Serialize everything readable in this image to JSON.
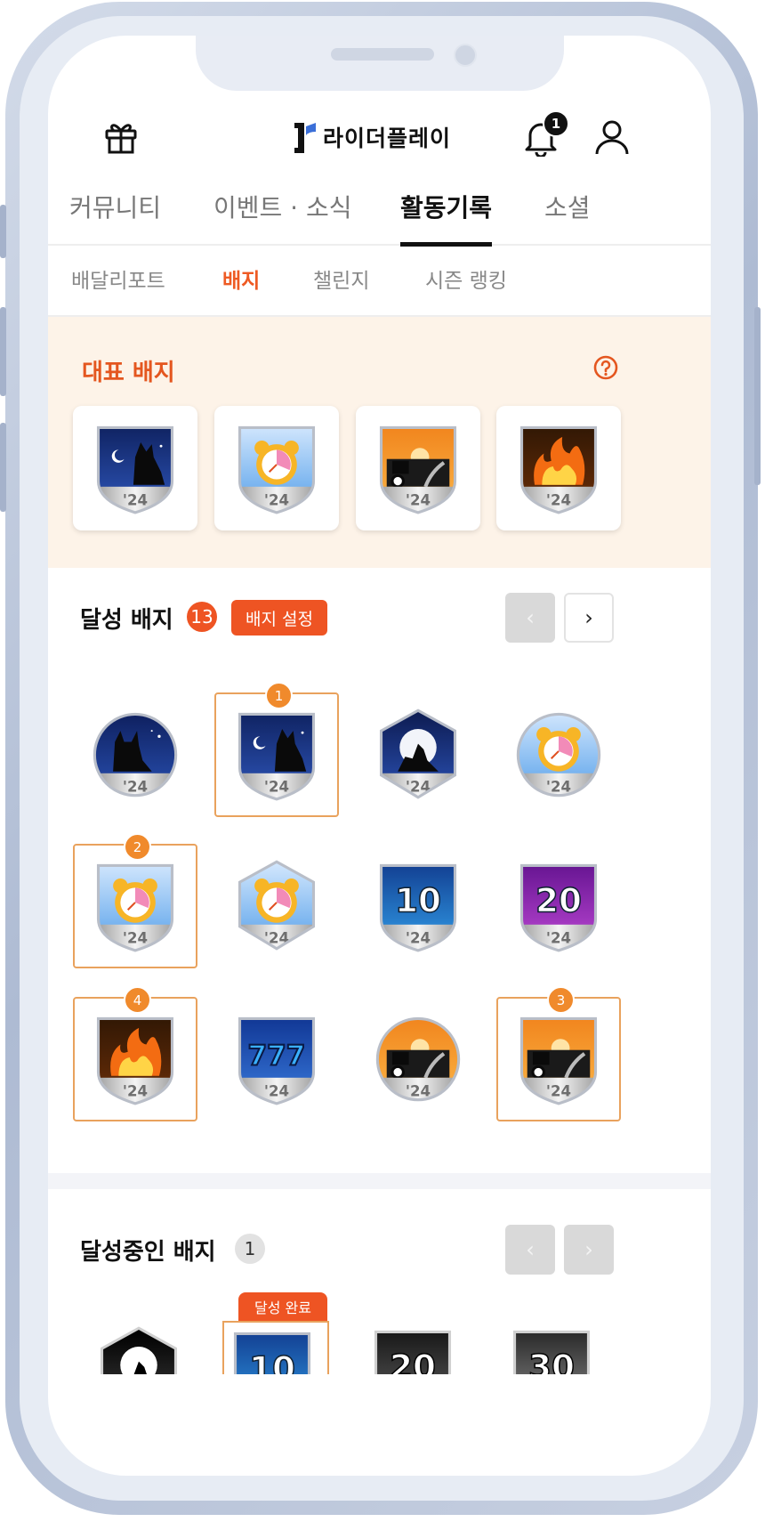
{
  "app": {
    "logo_text": "라이더플레이",
    "notification_count": "1"
  },
  "tabs": [
    {
      "label": "커뮤니티",
      "active": false
    },
    {
      "label": "이벤트 · 소식",
      "active": false
    },
    {
      "label": "활동기록",
      "active": true
    },
    {
      "label": "소셜",
      "active": false
    }
  ],
  "subtabs": [
    {
      "label": "배달리포트",
      "active": false
    },
    {
      "label": "배지",
      "active": true
    },
    {
      "label": "챌린지",
      "active": false
    },
    {
      "label": "시즌 랭킹",
      "active": false
    }
  ],
  "featured": {
    "title": "대표 배지",
    "badges": [
      "fox-moon-badge",
      "alarm-clock-badge",
      "delivery-sunset-badge",
      "fire-badge"
    ]
  },
  "achieved": {
    "title": "달성 배지",
    "count": "13",
    "settings_label": "배지 설정",
    "prev_label": "‹",
    "next_label": "›",
    "badges": [
      {
        "icon": "cat-moon-badge",
        "order": null
      },
      {
        "icon": "fox-moon-badge",
        "order": "1"
      },
      {
        "icon": "wolf-moon-badge",
        "order": null
      },
      {
        "icon": "alarm-clock-badge",
        "order": null
      },
      {
        "icon": "alarm-clock-badge",
        "order": "2"
      },
      {
        "icon": "alarm-clock-hex-badge",
        "order": null
      },
      {
        "icon": "number-10-badge",
        "order": null
      },
      {
        "icon": "number-20-badge",
        "order": null
      },
      {
        "icon": "fire-badge",
        "order": "4"
      },
      {
        "icon": "lucky-777-badge",
        "order": null
      },
      {
        "icon": "delivery-road-badge",
        "order": null
      },
      {
        "icon": "delivery-sunset-badge",
        "order": "3"
      }
    ],
    "badge_year": "'24"
  },
  "in_progress": {
    "title": "달성중인 배지",
    "count": "1",
    "complete_label": "달성 완료",
    "prev_label": "‹",
    "next_label": "›",
    "preview_numbers": [
      "10",
      "20",
      "30"
    ]
  },
  "colors": {
    "accent": "#ee5423",
    "featured_bg": "#fdf3e8",
    "selected_border": "#e9a25d"
  }
}
